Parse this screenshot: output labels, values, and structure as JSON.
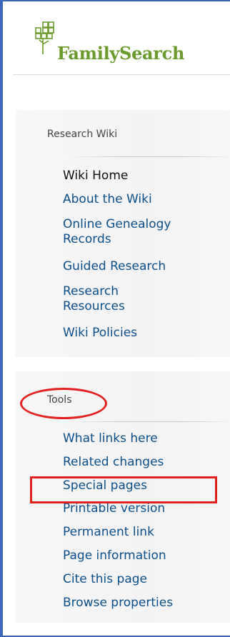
{
  "brand": {
    "name": "FamilySearch",
    "accent": "#6b9a2e"
  },
  "research_wiki": {
    "heading": "Research Wiki",
    "links": [
      {
        "label": "Wiki Home",
        "current": true
      },
      {
        "label": "About the Wiki"
      },
      {
        "label": "Online Genealogy Records"
      },
      {
        "label": "Guided Research"
      },
      {
        "label": "Research Resources"
      },
      {
        "label": "Wiki Policies"
      }
    ]
  },
  "tools": {
    "heading": "Tools",
    "links": [
      {
        "label": "What links here"
      },
      {
        "label": "Related changes"
      },
      {
        "label": "Special pages"
      },
      {
        "label": "Printable version",
        "highlighted": true
      },
      {
        "label": "Permanent link"
      },
      {
        "label": "Page information"
      },
      {
        "label": "Cite this page"
      },
      {
        "label": "Browse properties"
      }
    ]
  },
  "colors": {
    "link": "#0b4f8a",
    "frame_border": "#3a67b8",
    "annotation": "#e0211e"
  }
}
